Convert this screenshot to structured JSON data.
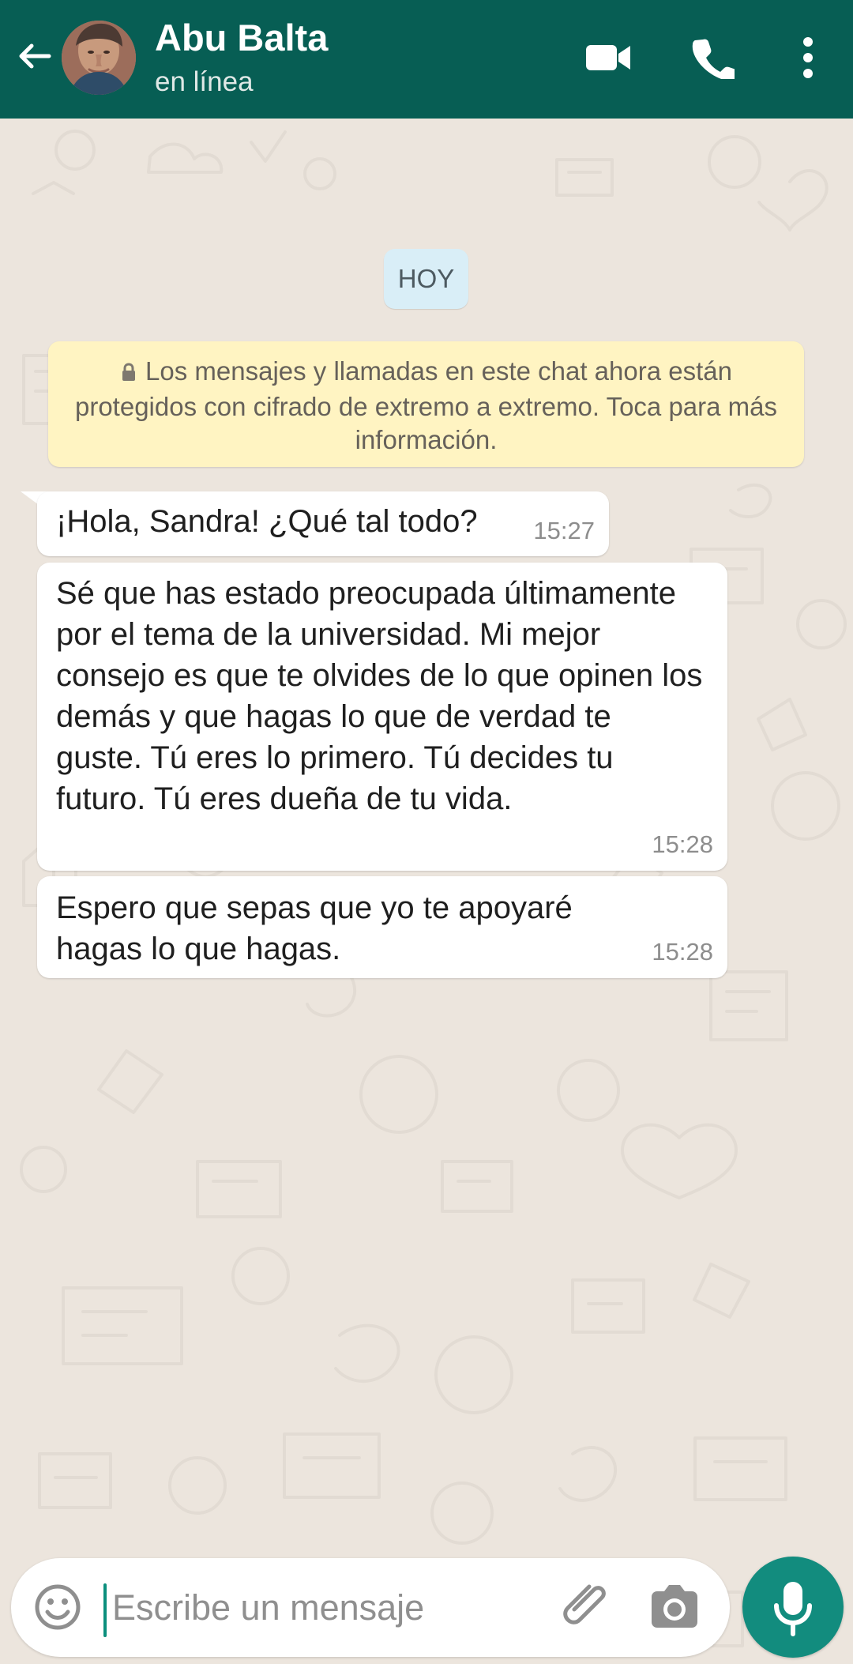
{
  "header": {
    "contact_name": "Abu Balta",
    "status": "en línea",
    "icons": [
      "back-arrow-icon",
      "contact-avatar",
      "video-camera-icon",
      "phone-icon",
      "more-options-icon"
    ]
  },
  "chat": {
    "date_chip": "HOY",
    "encryption_notice": "Los mensajes y llamadas en este chat ahora están protegidos con cifrado de extremo a extremo. Toca para más información.",
    "messages": [
      {
        "text": "¡Hola, Sandra! ¿Qué tal todo?",
        "time": "15:27"
      },
      {
        "text": "Sé que has estado preocupada últimamente por el tema de la universidad. Mi mejor consejo es que te olvides de lo que opinen los demás y que hagas lo que de verdad te guste. Tú eres lo primero. Tú decides tu futuro. Tú eres dueña de tu vida.",
        "time": "15:28"
      },
      {
        "text": "Espero que sepas que yo te apoyaré hagas lo que hagas.",
        "time": "15:28"
      }
    ]
  },
  "composer": {
    "placeholder": "Escribe un mensaje",
    "value": "",
    "icons": [
      "emoji-icon",
      "paperclip-icon",
      "camera-icon",
      "microphone-icon"
    ]
  },
  "colors": {
    "header": "#075e54",
    "accent": "#128c7e",
    "chat_background": "#ece5dd",
    "date_chip": "#d9eef7",
    "encryption_notice": "#fff4c2",
    "incoming_bubble": "#ffffff"
  }
}
